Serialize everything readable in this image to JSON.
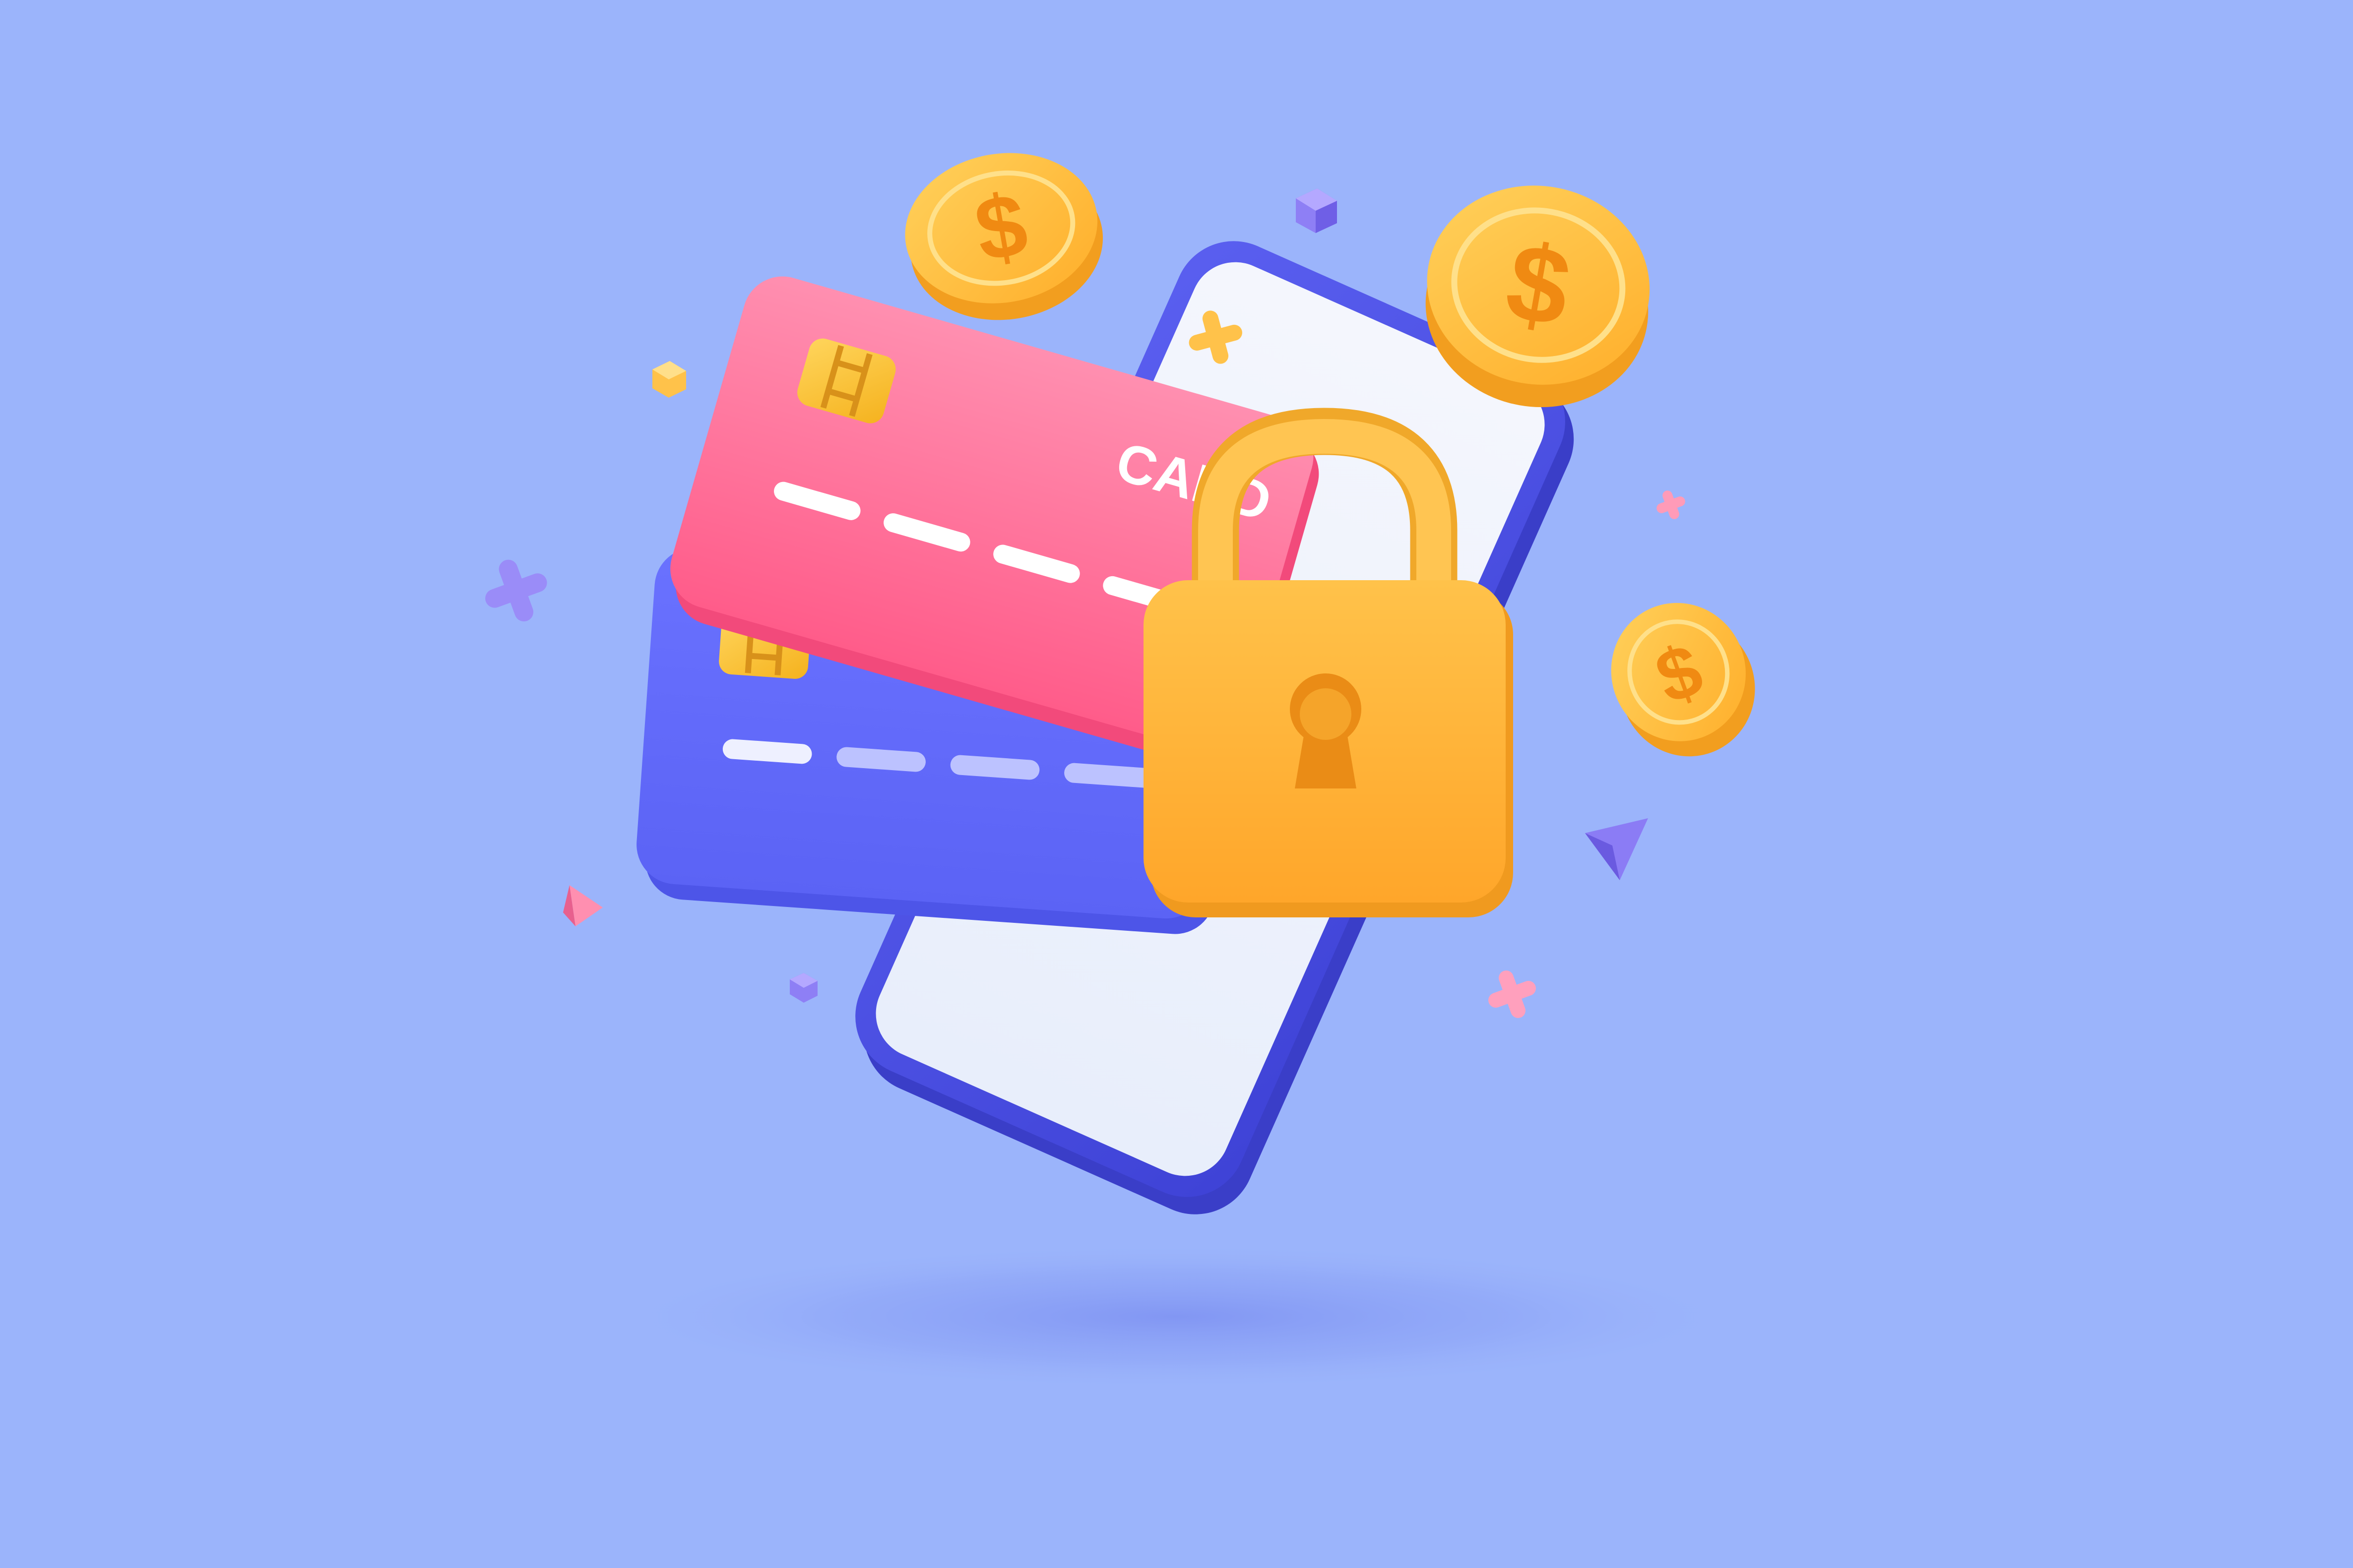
{
  "illustration": {
    "background_color": "#9bb4fb",
    "front_card": {
      "label": "CARD",
      "color_top": "#ff8fb0",
      "color_bottom": "#ff5c8a"
    },
    "back_card": {
      "color_top": "#6a72ff",
      "color_bottom": "#5b63f5"
    },
    "phone": {
      "frame_color": "#4b4fe0",
      "screen_color": "#e8eefb"
    },
    "padlock": {
      "body_color": "#ffb534",
      "shackle_color": "#ffbf45"
    },
    "coins": [
      {
        "symbol": "$"
      },
      {
        "symbol": "$"
      },
      {
        "symbol": "$"
      }
    ],
    "accent_colors": {
      "gold": "#ffb534",
      "pink": "#ff8fb0",
      "violet": "#8b7cf5"
    }
  }
}
